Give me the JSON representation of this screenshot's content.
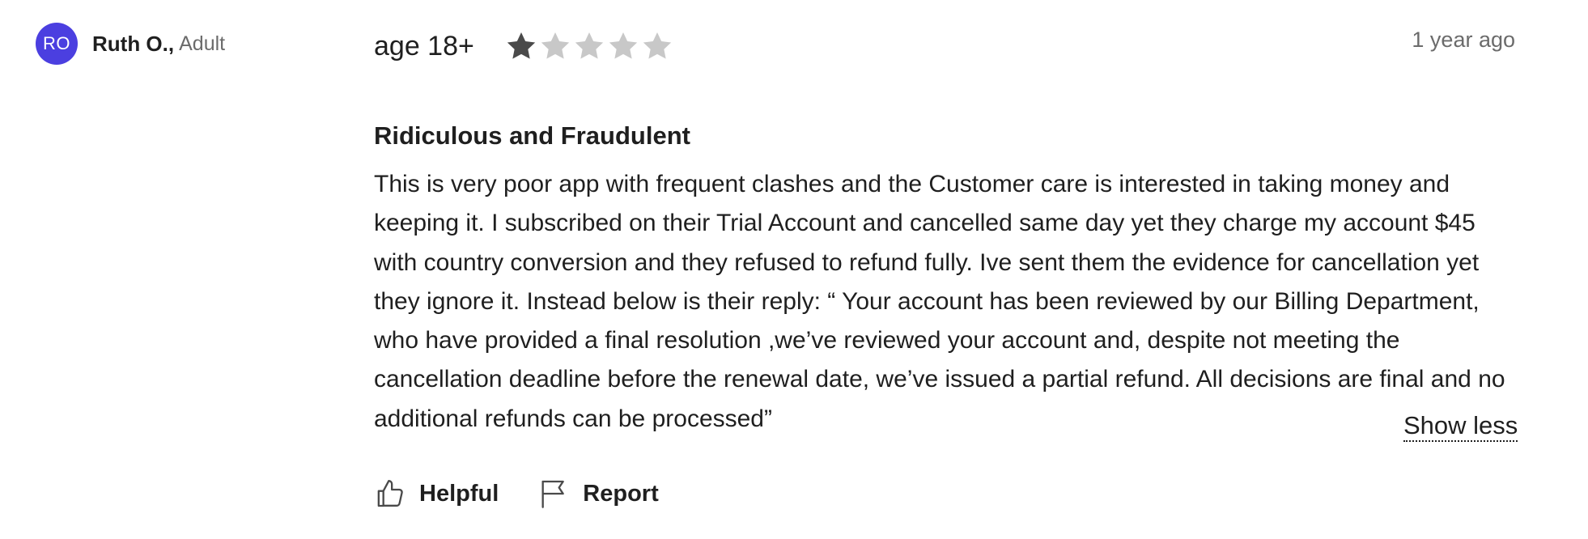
{
  "reviewer": {
    "initials": "RO",
    "name": "Ruth O.",
    "comma": ",",
    "role": "Adult",
    "avatar_color": "#4b3fe0"
  },
  "review": {
    "age": "age 18+",
    "rating": 1,
    "max_rating": 5,
    "timestamp": "1 year ago",
    "title": "Ridiculous and Fraudulent",
    "body": "This is very poor app with frequent clashes and the Customer care is interested in taking money and keeping it. I subscribed on their Trial Account and cancelled same day yet they charge my account $45 with country conversion and they refused to refund fully. Ive sent them the evidence for cancellation yet they ignore it. Instead below is their reply: “ Your account has been reviewed by our Billing Department, who have provided a final resolution ,we’ve reviewed your account and, despite not meeting the cancellation deadline before the renewal date, we’ve issued a partial refund. All decisions are final and no additional refunds can be processed”",
    "show_less_label": "Show less"
  },
  "actions": {
    "helpful_label": "Helpful",
    "helpful_icon": "thumbs-up-icon",
    "report_label": "Report",
    "report_icon": "flag-icon"
  },
  "colors": {
    "star_filled": "#4a4a4a",
    "star_empty": "#c8c8c8",
    "muted_text": "#6b6b6b"
  }
}
